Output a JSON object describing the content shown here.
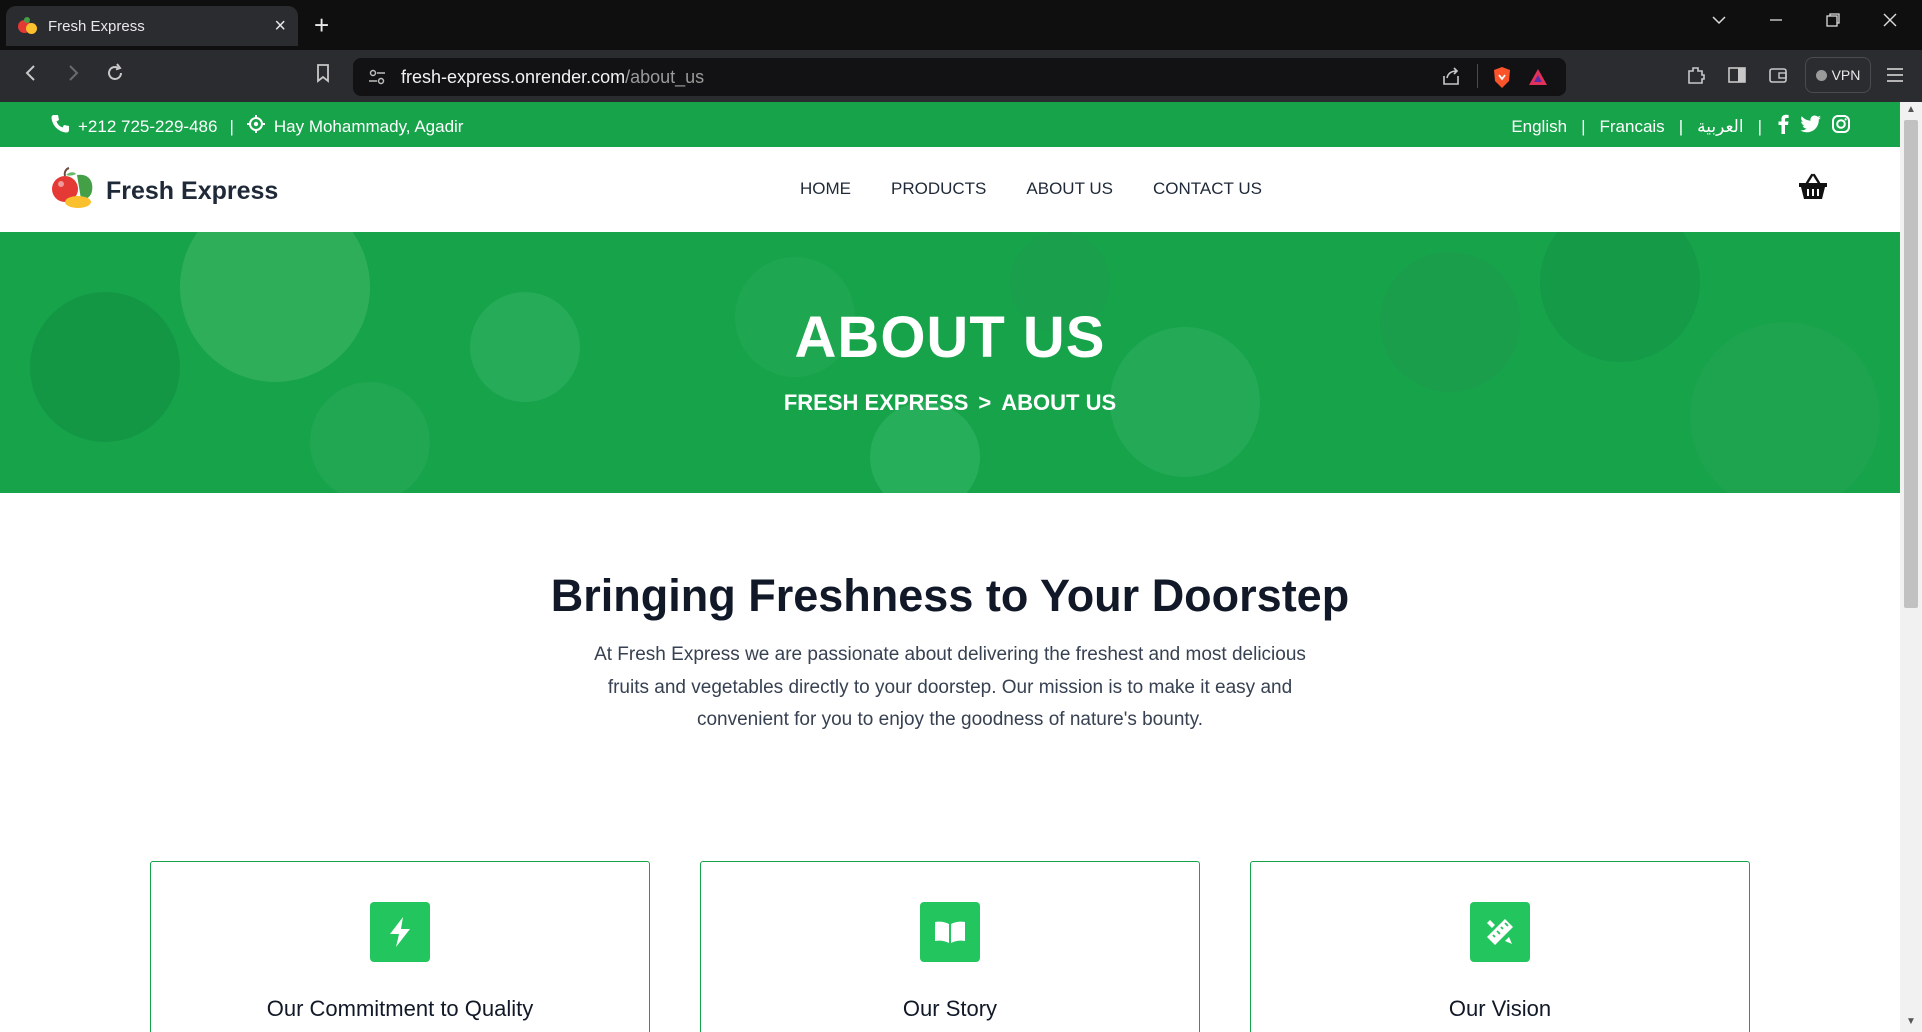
{
  "browser": {
    "tab_title": "Fresh Expr​ess",
    "url_host": "fresh-express.onrender.com",
    "url_path": "/about_us",
    "vpn_label": "VPN"
  },
  "topbar": {
    "phone": "+212 725-229-486",
    "divider": "|",
    "address": "Hay Mohammady, Agadir",
    "languages": [
      "English",
      "Francais",
      "العربية"
    ]
  },
  "nav": {
    "brand": "Fresh Express",
    "items": [
      "HOME",
      "PRODUCTS",
      "ABOUT US",
      "CONTACT US"
    ]
  },
  "hero": {
    "title": "ABOUT US",
    "crumb_home": "FRESH EXPRESS",
    "crumb_sep": ">",
    "crumb_current": "ABOUT US"
  },
  "intro": {
    "title": "Bringing Freshness to Your Doorstep",
    "text": "At Fresh Express we are passionate about delivering the freshest and most delicious fruits and vegetables directly to your doorstep. Our mission is to make it easy and convenient for you to enjoy the goodness of nature's bounty."
  },
  "cards": [
    {
      "title": "Our Commitment to Quality",
      "icon": "bolt-icon"
    },
    {
      "title": "Our Story",
      "icon": "book-icon"
    },
    {
      "title": "Our Vision",
      "icon": "pencil-ruler-icon"
    }
  ],
  "colors": {
    "brand_green": "#16a34a",
    "icon_green": "#22c55e"
  }
}
